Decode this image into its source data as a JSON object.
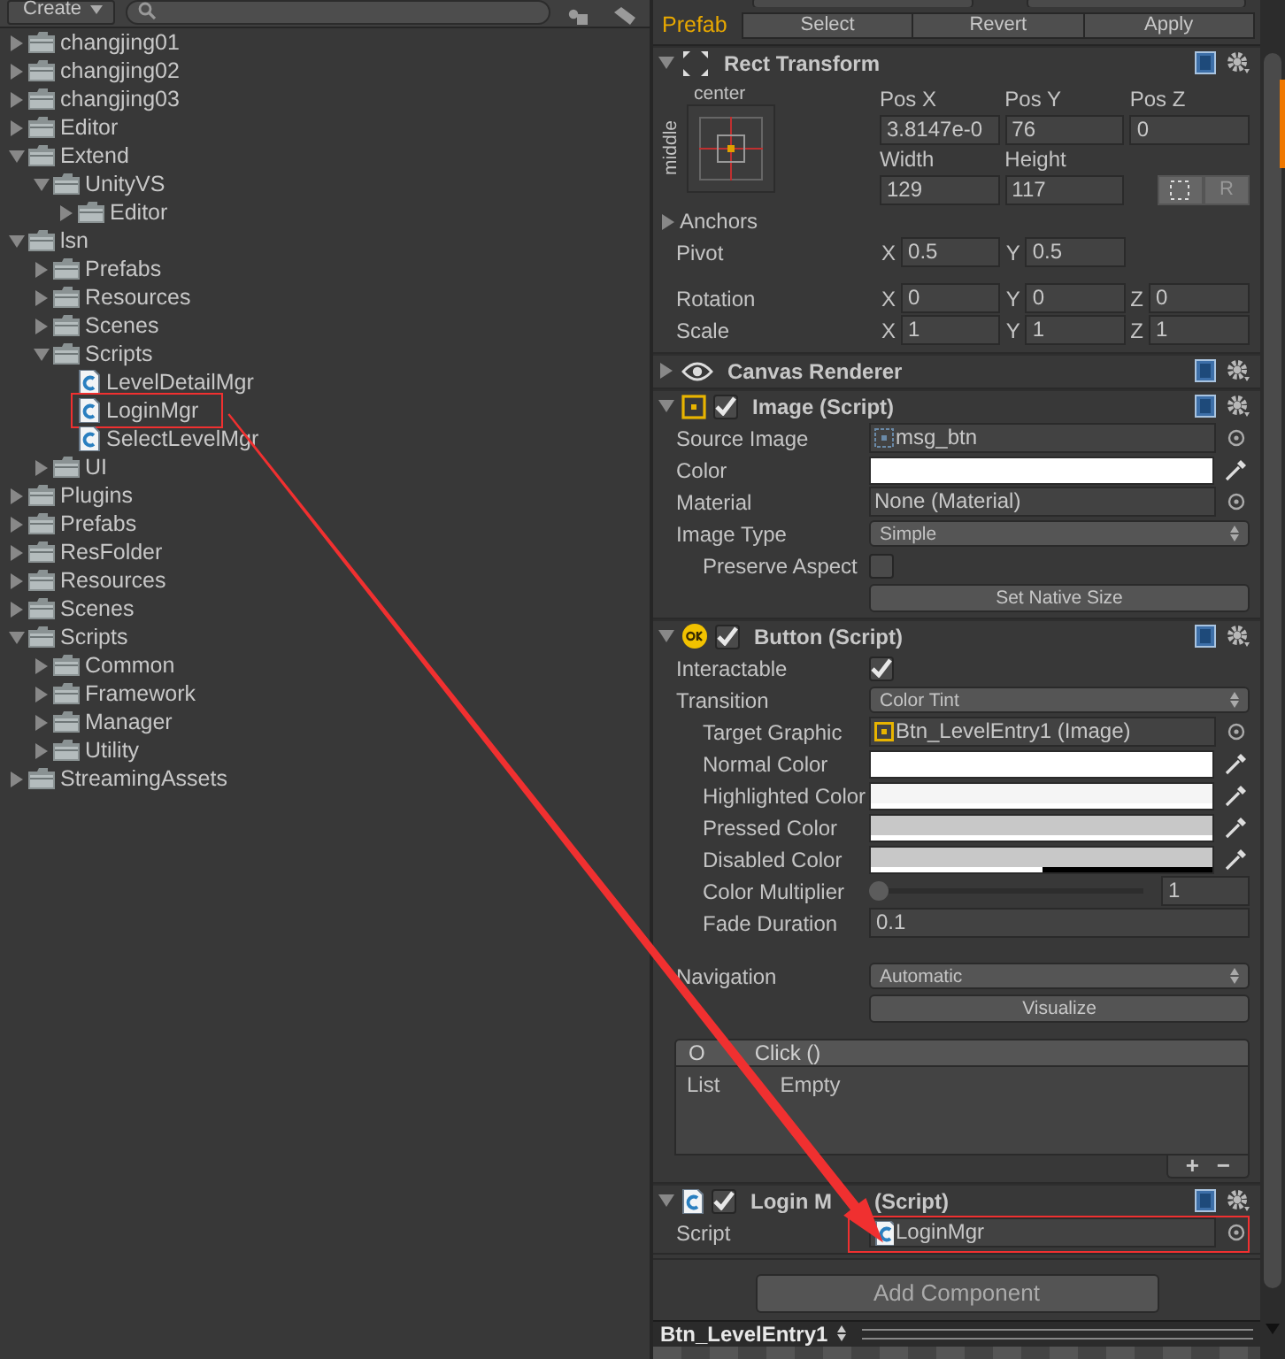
{
  "project": {
    "create_button": "Create",
    "tree": [
      {
        "label": "changjing01",
        "kind": "folder",
        "expanded": false
      },
      {
        "label": "changjing02",
        "kind": "folder",
        "expanded": false
      },
      {
        "label": "changjing03",
        "kind": "folder",
        "expanded": false
      },
      {
        "label": "Editor",
        "kind": "folder",
        "expanded": false
      },
      {
        "label": "Extend",
        "kind": "folder",
        "expanded": true,
        "children": [
          {
            "label": "UnityVS",
            "kind": "folder",
            "expanded": true,
            "children": [
              {
                "label": "Editor",
                "kind": "folder",
                "expanded": false
              }
            ]
          }
        ]
      },
      {
        "label": "lsn",
        "kind": "folder",
        "expanded": true,
        "children": [
          {
            "label": "Prefabs",
            "kind": "folder",
            "expanded": false
          },
          {
            "label": "Resources",
            "kind": "folder",
            "expanded": false
          },
          {
            "label": "Scenes",
            "kind": "folder",
            "expanded": false
          },
          {
            "label": "Scripts",
            "kind": "folder",
            "expanded": true,
            "children": [
              {
                "label": "LevelDetailMgr",
                "kind": "script"
              },
              {
                "label": "LoginMgr",
                "kind": "script",
                "boxed": true
              },
              {
                "label": "SelectLevelMgr",
                "kind": "script"
              }
            ]
          },
          {
            "label": "UI",
            "kind": "folder",
            "expanded": false
          }
        ]
      },
      {
        "label": "Plugins",
        "kind": "folder",
        "expanded": false
      },
      {
        "label": "Prefabs",
        "kind": "folder",
        "expanded": false
      },
      {
        "label": "ResFolder",
        "kind": "folder",
        "expanded": false
      },
      {
        "label": "Resources",
        "kind": "folder",
        "expanded": false
      },
      {
        "label": "Scenes",
        "kind": "folder",
        "expanded": false
      },
      {
        "label": "Scripts",
        "kind": "folder",
        "expanded": true,
        "children": [
          {
            "label": "Common",
            "kind": "folder",
            "expanded": false
          },
          {
            "label": "Framework",
            "kind": "folder",
            "expanded": false
          },
          {
            "label": "Manager",
            "kind": "folder",
            "expanded": false
          },
          {
            "label": "Utility",
            "kind": "folder",
            "expanded": false
          }
        ]
      },
      {
        "label": "StreamingAssets",
        "kind": "folder",
        "expanded": false
      }
    ]
  },
  "inspector": {
    "prefab": {
      "label": "Prefab",
      "buttons": [
        "Select",
        "Revert",
        "Apply"
      ]
    },
    "components": [
      {
        "kind": "rect_transform",
        "title": "Rect Transform",
        "expanded": true,
        "anchor_preset": {
          "horizontal": "center",
          "vertical": "middle"
        },
        "fields": [
          {
            "label": "Pos X",
            "value": "3.8147e-0"
          },
          {
            "label": "Pos Y",
            "value": "76"
          },
          {
            "label": "Pos Z",
            "value": "0"
          },
          {
            "label": "Width",
            "value": "129"
          },
          {
            "label": "Height",
            "value": "117"
          }
        ],
        "raw_button": "R",
        "anchors": {
          "label": "Anchors",
          "expanded": false
        },
        "vectors": [
          {
            "label": "Pivot",
            "axes": [
              {
                "axis": "X",
                "value": "0.5"
              },
              {
                "axis": "Y",
                "value": "0.5"
              }
            ]
          },
          {
            "label": "Rotation",
            "gap_before": true,
            "axes": [
              {
                "axis": "X",
                "value": "0"
              },
              {
                "axis": "Y",
                "value": "0"
              },
              {
                "axis": "Z",
                "value": "0"
              }
            ]
          },
          {
            "label": "Scale",
            "axes": [
              {
                "axis": "X",
                "value": "1"
              },
              {
                "axis": "Y",
                "value": "1"
              },
              {
                "axis": "Z",
                "value": "1"
              }
            ]
          }
        ]
      },
      {
        "kind": "canvas_renderer",
        "title": "Canvas Renderer",
        "expanded": false
      },
      {
        "kind": "image",
        "title": "Image (Script)",
        "expanded": true,
        "enabled": true,
        "rows": [
          {
            "kind": "sprite_ref",
            "label": "Source Image",
            "value": "msg_btn"
          },
          {
            "kind": "color",
            "label": "Color",
            "color": "#ffffff",
            "level": 1
          },
          {
            "kind": "object",
            "label": "Material",
            "value": "None (Material)"
          },
          {
            "kind": "dropdown",
            "label": "Image Type",
            "value": "Simple"
          },
          {
            "kind": "toggle",
            "label": "Preserve Aspect",
            "indented": true,
            "checked": false
          },
          {
            "kind": "button",
            "label": "Set Native Size"
          }
        ]
      },
      {
        "kind": "button",
        "title": "Button (Script)",
        "expanded": true,
        "enabled": true,
        "rows": [
          {
            "kind": "toggle",
            "label": "Interactable",
            "checked": true
          },
          {
            "kind": "dropdown",
            "label": "Transition",
            "value": "Color Tint"
          },
          {
            "kind": "component_ref",
            "label": "Target Graphic",
            "indented": true,
            "value": "Btn_LevelEntry1 (Image)"
          },
          {
            "kind": "color",
            "label": "Normal Color",
            "indented": true,
            "color": "#ffffff",
            "level": 1
          },
          {
            "kind": "color",
            "label": "Highlighted Color",
            "indented": true,
            "color": "#f5f5f5",
            "level": 1
          },
          {
            "kind": "color",
            "label": "Pressed Color",
            "indented": true,
            "color": "#c8c8c8",
            "level": 1
          },
          {
            "kind": "color",
            "label": "Disabled Color",
            "indented": true,
            "color": "#c8c8c8",
            "level": 0.5
          },
          {
            "kind": "slider",
            "label": "Color Multiplier",
            "indented": true,
            "level": 0,
            "value": "1"
          },
          {
            "kind": "float",
            "label": "Fade Duration",
            "indented": true,
            "value": "0.1"
          },
          {
            "kind": "dropdown",
            "label": "Navigation",
            "gap_before": true,
            "value": "Automatic"
          },
          {
            "kind": "button",
            "label": "Visualize"
          },
          {
            "kind": "event",
            "label": [
              "O",
              "Click ()"
            ],
            "empty_text": [
              "List",
              "Empty"
            ],
            "add": "+",
            "remove": "−"
          }
        ]
      },
      {
        "kind": "script",
        "title": [
          "Login M",
          "(Script)"
        ],
        "expanded": true,
        "enabled": true,
        "rows": [
          {
            "kind": "script_ref",
            "label": "Script",
            "value": "LoginMgr",
            "boxed": true
          }
        ]
      }
    ],
    "add_component": "Add Component"
  },
  "preview": {
    "title": "Btn_LevelEntry1"
  },
  "annotation": {
    "arrow": true
  }
}
